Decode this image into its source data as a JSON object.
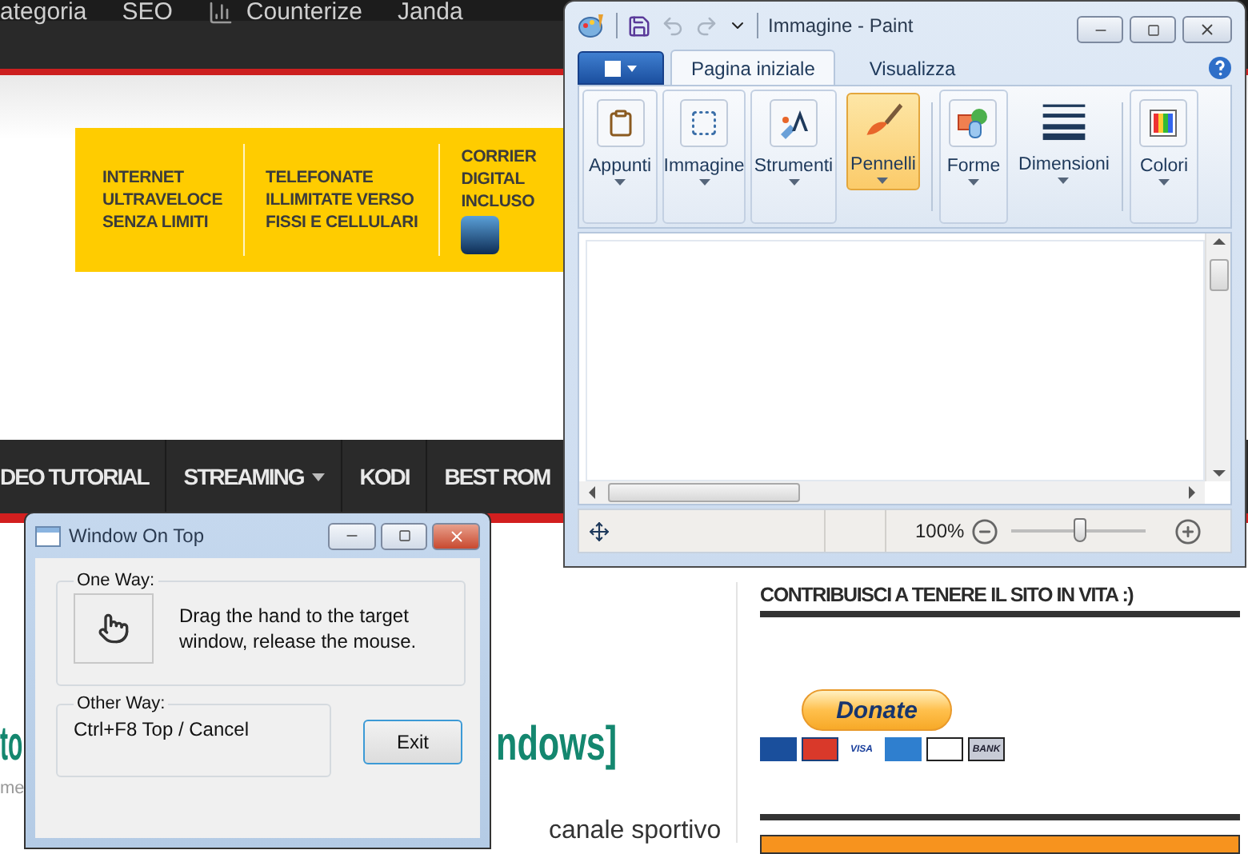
{
  "webpage": {
    "top_menu": [
      {
        "label": "ategoria",
        "icon": false
      },
      {
        "label": "SEO",
        "icon": false
      },
      {
        "label": "Counterize",
        "icon": true
      },
      {
        "label": "Janda",
        "icon": false
      }
    ],
    "banner": [
      [
        "INTERNET",
        "ULTRAVELOCE",
        "SENZA LIMITI"
      ],
      [
        "TELEFONATE",
        "ILLIMITATE VERSO",
        "FISSI E CELLULARI"
      ],
      [
        "CORRIER",
        "DIGITAL",
        "INCLUSO"
      ]
    ],
    "nav": [
      {
        "label": "DEO TUTORIAL",
        "dropdown": false
      },
      {
        "label": "STREAMING",
        "dropdown": true
      },
      {
        "label": "KODI",
        "dropdown": false
      },
      {
        "label": "BEST ROM",
        "dropdown": false
      }
    ],
    "article": {
      "title_parts": [
        "to",
        "ndows]"
      ],
      "meta": "me",
      "body": "canale sportivo"
    },
    "sidebar": {
      "heading": "CONTRIBUISCI A TENERE IL SITO IN VITA :)",
      "donate": "Donate",
      "cards": [
        {
          "kind": "maestro"
        },
        {
          "kind": "mastercard"
        },
        {
          "kind": "visa",
          "label": "VISA"
        },
        {
          "kind": "amex"
        },
        {
          "kind": "discover"
        },
        {
          "kind": "bank",
          "label": "BANK"
        }
      ]
    }
  },
  "paint": {
    "title": "Immagine - Paint",
    "tabs": [
      {
        "label": "Pagina iniziale",
        "selected": true
      },
      {
        "label": "Visualizza",
        "selected": false
      }
    ],
    "ribbon": [
      {
        "label": "Appunti",
        "framed": true,
        "group_start": false,
        "selected": false
      },
      {
        "label": "Immagine",
        "framed": true,
        "group_start": false,
        "selected": false
      },
      {
        "label": "Strumenti",
        "framed": true,
        "group_start": false,
        "selected": false
      },
      {
        "label": "Pennelli",
        "framed": false,
        "group_start": false,
        "selected": true
      },
      {
        "label": "Forme",
        "framed": true,
        "group_start": true,
        "selected": false
      },
      {
        "label": "Dimensioni",
        "framed": false,
        "group_start": false,
        "selected": false
      },
      {
        "label": "Colori",
        "framed": true,
        "group_start": true,
        "selected": false
      }
    ],
    "zoom": {
      "reading": "100%",
      "level": 0.52
    }
  },
  "window_on_top": {
    "title": "Window On Top",
    "one_way": {
      "legend": "One Way:",
      "text": "Drag the hand to the target window, release the mouse."
    },
    "other_way": {
      "legend": "Other Way:",
      "text": "Ctrl+F8  Top / Cancel"
    },
    "exit": "Exit"
  }
}
